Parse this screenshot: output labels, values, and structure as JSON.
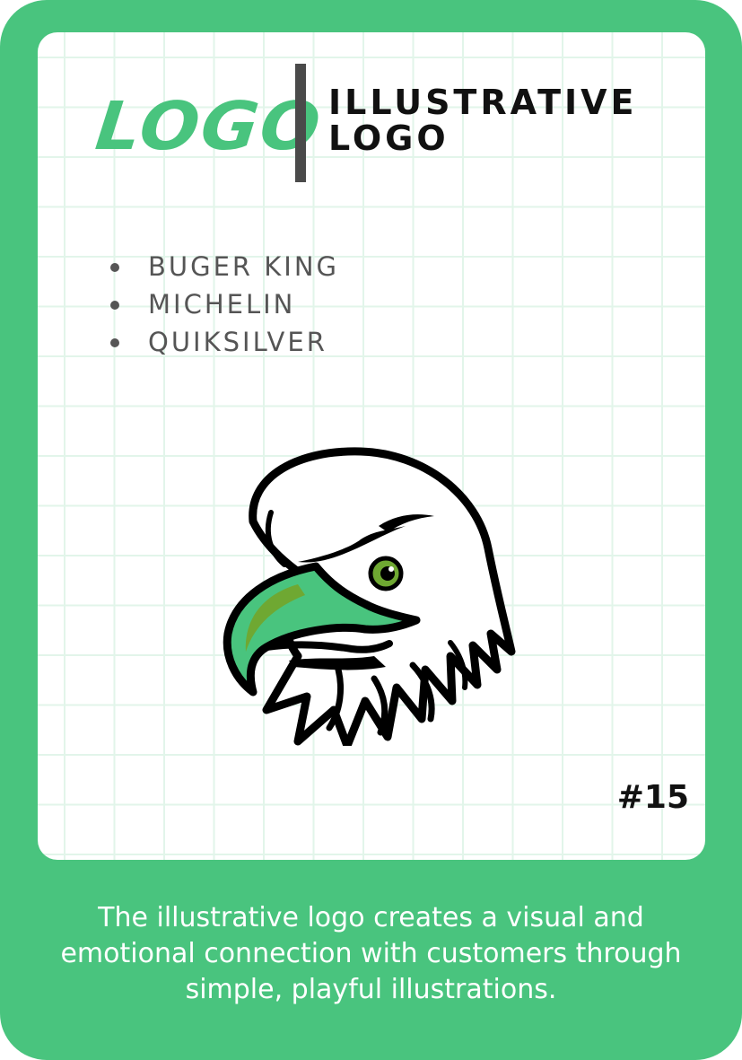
{
  "header": {
    "logo_word": "LOGO",
    "title_line1": "ILLUSTRATIVE",
    "title_line2": "LOGO"
  },
  "examples": [
    "BUGER KING",
    "MICHELIN",
    "QUIKSILVER"
  ],
  "illustration": {
    "icon": "eagle-head-icon",
    "accent_color": "#49c47e",
    "eye_color": "#6fa832"
  },
  "card_number": "#15",
  "description": "The illustrative logo creates a visual and emotional connection with customers through simple, playful illustrations.",
  "colors": {
    "brand_green": "#49c47e",
    "text_dark": "#111111",
    "text_gray": "#555555",
    "grid": "#e2f5ea"
  }
}
